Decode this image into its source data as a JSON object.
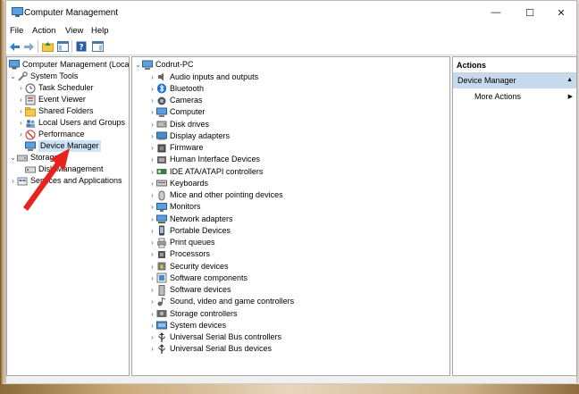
{
  "window": {
    "title": "Computer Management",
    "controls": [
      "—",
      "☐",
      "✕"
    ]
  },
  "menubar": [
    "File",
    "Action",
    "View",
    "Help"
  ],
  "left_tree": {
    "root": "Computer Management (Local",
    "system_tools": "System Tools",
    "items": [
      "Task Scheduler",
      "Event Viewer",
      "Shared Folders",
      "Local Users and Groups",
      "Performance",
      "Device Manager"
    ],
    "storage": "Storage",
    "storage_items": [
      "Disk Management"
    ],
    "services": "Services and Applications"
  },
  "device_tree": {
    "root": "Codrut-PC",
    "categories": [
      {
        "label": "Audio inputs and outputs",
        "icon": "speaker-icon"
      },
      {
        "label": "Bluetooth",
        "icon": "bluetooth-icon"
      },
      {
        "label": "Cameras",
        "icon": "camera-icon"
      },
      {
        "label": "Computer",
        "icon": "computer-icon"
      },
      {
        "label": "Disk drives",
        "icon": "disk-drive-icon"
      },
      {
        "label": "Display adapters",
        "icon": "display-adapter-icon"
      },
      {
        "label": "Firmware",
        "icon": "firmware-icon"
      },
      {
        "label": "Human Interface Devices",
        "icon": "hid-icon"
      },
      {
        "label": "IDE ATA/ATAPI controllers",
        "icon": "ide-controller-icon"
      },
      {
        "label": "Keyboards",
        "icon": "keyboard-icon"
      },
      {
        "label": "Mice and other pointing devices",
        "icon": "mouse-icon"
      },
      {
        "label": "Monitors",
        "icon": "monitor-icon"
      },
      {
        "label": "Network adapters",
        "icon": "network-adapter-icon"
      },
      {
        "label": "Portable Devices",
        "icon": "portable-device-icon"
      },
      {
        "label": "Print queues",
        "icon": "printer-icon"
      },
      {
        "label": "Processors",
        "icon": "processor-icon"
      },
      {
        "label": "Security devices",
        "icon": "security-device-icon"
      },
      {
        "label": "Software components",
        "icon": "software-component-icon"
      },
      {
        "label": "Software devices",
        "icon": "software-device-icon"
      },
      {
        "label": "Sound, video and game controllers",
        "icon": "sound-controller-icon"
      },
      {
        "label": "Storage controllers",
        "icon": "storage-controller-icon"
      },
      {
        "label": "System devices",
        "icon": "system-device-icon"
      },
      {
        "label": "Universal Serial Bus controllers",
        "icon": "usb-icon"
      },
      {
        "label": "Universal Serial Bus devices",
        "icon": "usb-icon"
      }
    ]
  },
  "actions": {
    "header": "Actions",
    "group": "Device Manager",
    "more": "More Actions"
  },
  "colors": {
    "selection": "#cce4f7",
    "actions_group_bg": "#c7d9ec",
    "annotation_arrow": "#e8231e"
  }
}
